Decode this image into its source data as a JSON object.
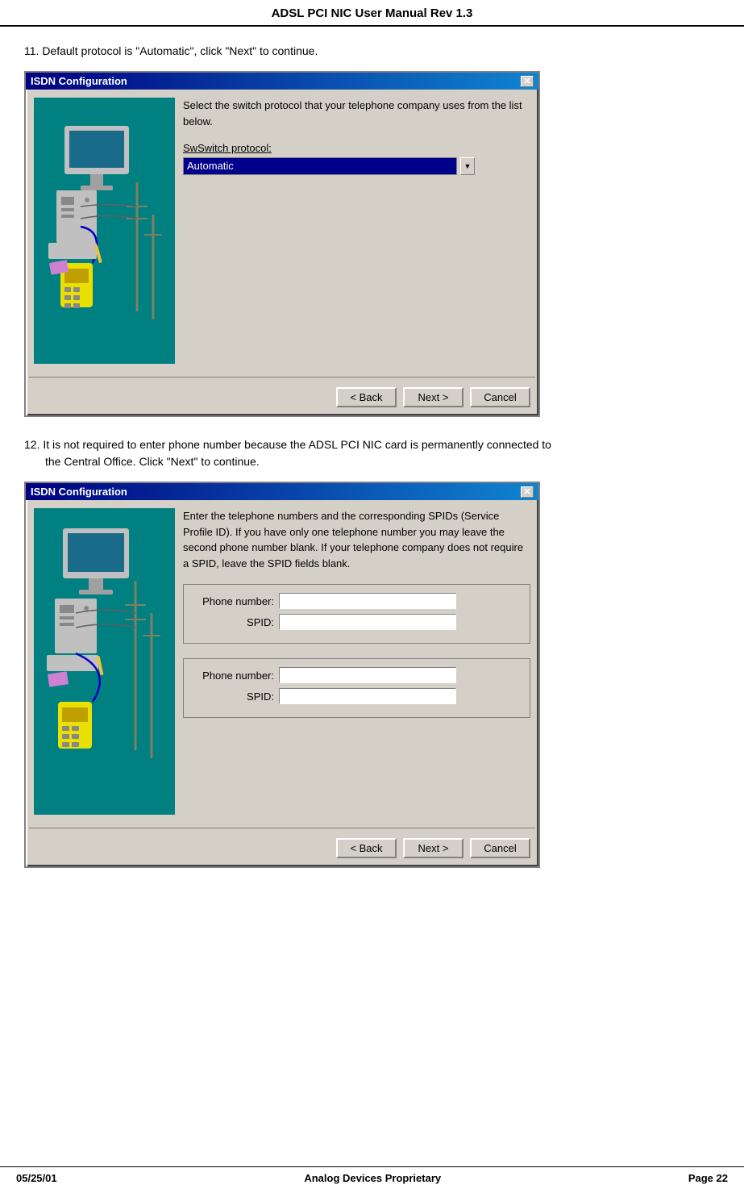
{
  "header": {
    "title": "ADSL PCI NIC User Manual Rev 1.3"
  },
  "footer": {
    "date": "05/25/01",
    "company": "Analog Devices Proprietary",
    "page": "Page 22"
  },
  "step11": {
    "text": "11.  Default protocol is \"Automatic\", click \"Next\" to continue.",
    "dialog": {
      "title": "ISDN Configuration",
      "close_label": "✕",
      "description": "Select the switch protocol that your telephone company uses from the list below.",
      "switch_protocol_label": "Switch protocol:",
      "dropdown_value": "Automatic",
      "back_btn": "< Back",
      "next_btn": "Next >",
      "cancel_btn": "Cancel"
    }
  },
  "step12": {
    "text1": "12.  It is not required to enter phone number because the ADSL PCI NIC card is permanently connected to",
    "text2": "the Central Office.  Click \"Next\" to continue.",
    "dialog": {
      "title": "ISDN Configuration",
      "close_label": "✕",
      "description": "Enter the telephone numbers and the corresponding SPIDs (Service Profile ID).  If you have only one telephone number you may leave the second phone number blank.  If your telephone company does not require a SPID, leave the SPID fields blank.",
      "phone_label_1": "Phone number:",
      "spid_label_1": "SPID:",
      "phone_label_2": "Phone number:",
      "spid_label_2": "SPID:",
      "back_btn": "< Back",
      "next_btn": "Next >",
      "cancel_btn": "Cancel"
    }
  }
}
